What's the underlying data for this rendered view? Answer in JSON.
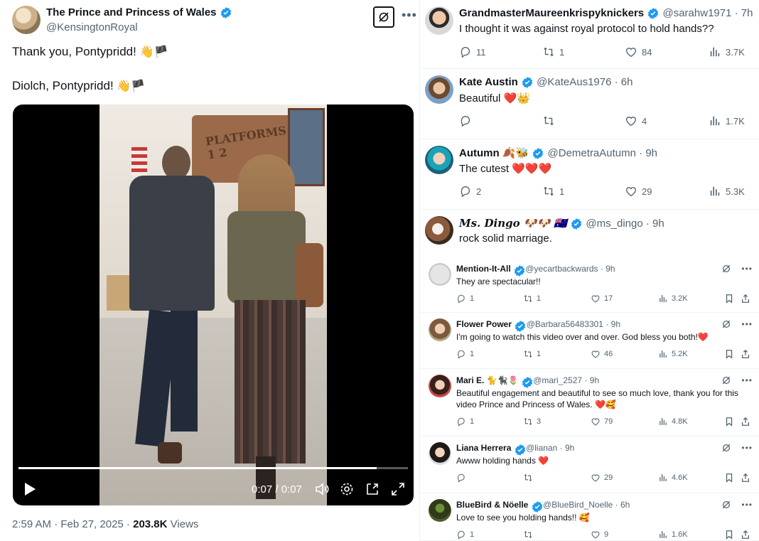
{
  "main_tweet": {
    "author_name": "The Prince and Princess of Wales",
    "author_handle": "@KensingtonRoyal",
    "text_line1": "Thank you, Pontypridd!",
    "text_line1_emoji": "👋🏴",
    "text_line2": "Diolch, Pontypridd!",
    "text_line2_emoji": "👋🏴",
    "video": {
      "time": "0:07 / 0:07",
      "progress": 0.92,
      "sign_text": "PLATFORMS 1 2"
    },
    "timestamp": "2:59 AM · Feb 27, 2025 · ",
    "views_count": "203.8K",
    "views_label": "Views"
  },
  "colors": {
    "verified": "#1d9bf0",
    "heart": "#e0245e",
    "muted": "#536471"
  },
  "replies": [
    {
      "name": "GrandmasterMaureenkrispyknickers",
      "handle": "@sarahw1971",
      "time": "· 7h",
      "text": "I thought it was against royal protocol to hold hands??",
      "replies": "11",
      "reposts": "1",
      "likes": "84",
      "views": "3.7K"
    },
    {
      "name": "Kate Austin",
      "handle": "@KateAus1976",
      "time": "· 6h",
      "text": "Beautiful ❤️👑",
      "replies": "",
      "reposts": "",
      "likes": "4",
      "views": "1.7K"
    },
    {
      "name": "Autumn 🍂🐝",
      "handle": "@DemetraAutumn",
      "time": "· 9h",
      "text": "The cutest ❤️❤️❤️",
      "replies": "2",
      "reposts": "1",
      "likes": "29",
      "views": "5.3K"
    },
    {
      "name": "Ms. Dingo 🐶🐶 🇦🇺",
      "handle": "@ms_dingo",
      "time": "· 9h",
      "text": "rock solid marriage."
    }
  ],
  "nested_replies": [
    {
      "name": "Mention-It-All",
      "handle": "@yecartbackwards",
      "time": "· 9h",
      "text": "They are spectacular!!",
      "replies": "1",
      "reposts": "1",
      "likes": "17",
      "views": "3.2K"
    },
    {
      "name": "Flower Power",
      "handle": "@Barbara56483301",
      "time": "· 9h",
      "text": "I'm going to watch this video over and over. God bless you both!❤️",
      "replies": "1",
      "reposts": "1",
      "likes": "46",
      "views": "5.2K"
    },
    {
      "name": "Mari E. 🐈🐈‍⬛🌷",
      "handle": "@mari_2527",
      "time": "· 9h",
      "text": "Beautiful engagement and beautiful to see so much love, thank you for this video Prince and Princess of Wales. ❤️🥰",
      "replies": "1",
      "reposts": "3",
      "likes": "79",
      "views": "4.8K"
    },
    {
      "name": "Liana Herrera",
      "handle": "@lianan",
      "time": "· 9h",
      "text": "Awww holding hands ❤️",
      "replies": "",
      "reposts": "",
      "likes": "29",
      "views": "4.6K"
    },
    {
      "name": "BlueBird & Nöelle",
      "handle": "@BlueBird_Noelle",
      "time": "· 6h",
      "text": "Love to see you holding hands!! 🥰",
      "replies": "1",
      "reposts": "",
      "likes": "9",
      "views": "1.6K"
    }
  ],
  "icons": {
    "reply": "reply-icon",
    "repost": "repost-icon",
    "like": "heart-icon",
    "views": "views-icon",
    "grok": "grok-icon",
    "more": "more-icon",
    "bookmark": "bookmark-icon",
    "share": "share-icon"
  }
}
